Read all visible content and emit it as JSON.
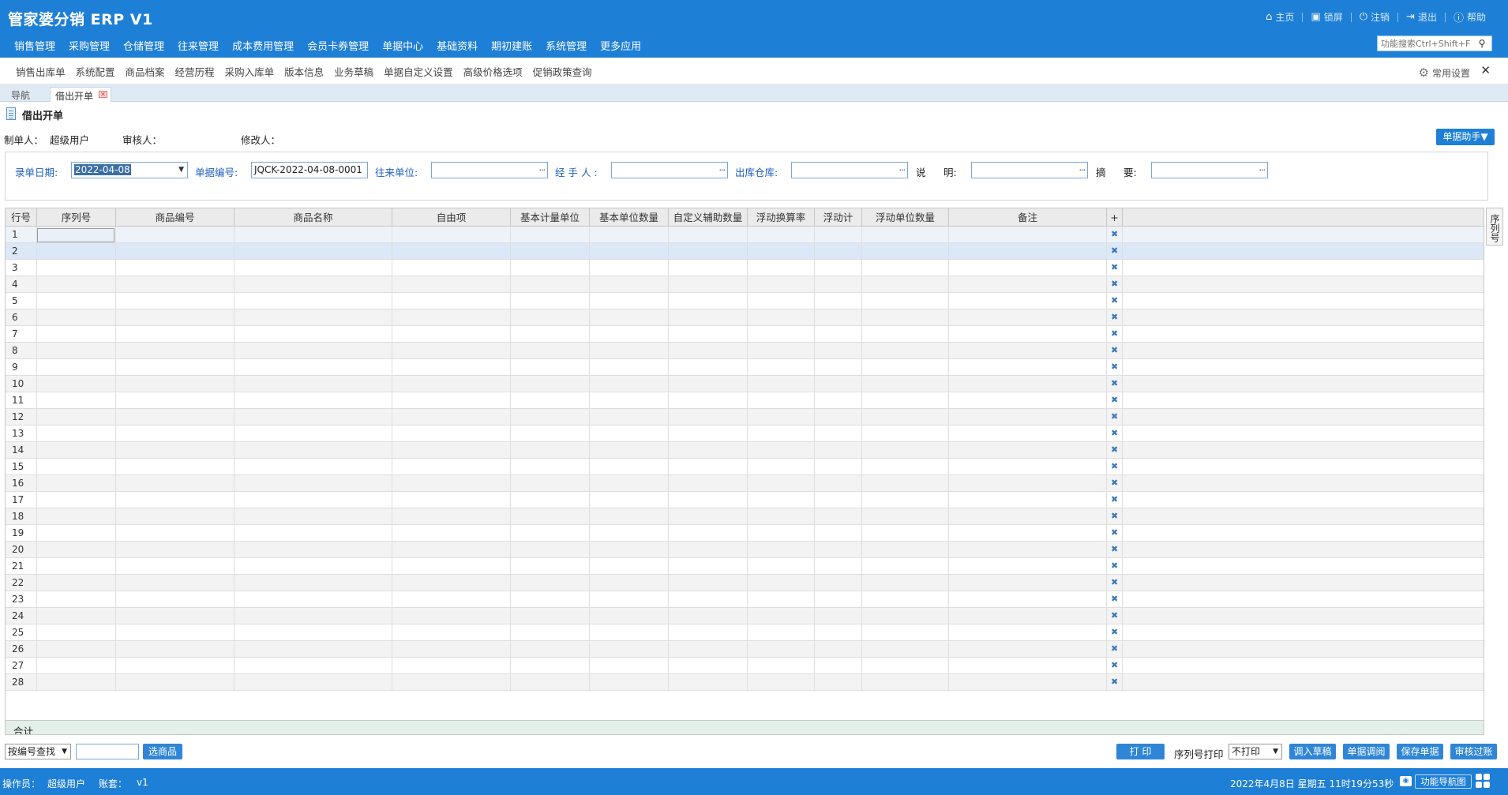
{
  "app": {
    "title": "管家婆分销 ERP V1"
  },
  "top_links": [
    {
      "label": "主页",
      "icon": "home-icon"
    },
    {
      "label": "锁屏",
      "icon": "lock-icon"
    },
    {
      "label": "注销",
      "icon": "power-icon"
    },
    {
      "label": "退出",
      "icon": "exit-icon"
    },
    {
      "label": "帮助",
      "icon": "info-icon"
    }
  ],
  "main_menu": [
    "销售管理",
    "采购管理",
    "仓储管理",
    "往来管理",
    "成本费用管理",
    "会员卡券管理",
    "单据中心",
    "基础资料",
    "期初建账",
    "系统管理",
    "更多应用"
  ],
  "search": {
    "placeholder": "功能搜索Ctrl+Shift+F"
  },
  "quick_links": [
    "销售出库单",
    "系统配置",
    "商品档案",
    "经营历程",
    "采购入库单",
    "版本信息",
    "业务草稿",
    "单据自定义设置",
    "高级价格选项",
    "促销政策查询"
  ],
  "quickbar": {
    "settings_label": "常用设置",
    "close": "✕"
  },
  "tabs": {
    "nav": "导航",
    "active": "借出开单",
    "close": "✕"
  },
  "doc": {
    "title": "借出开单",
    "maker_label": "制单人：",
    "maker_value": "超级用户",
    "auditor_label": "审核人：",
    "modifier_label": "修改人：",
    "assistant_button": "单据助手▼"
  },
  "form": {
    "date_label": "录单日期:",
    "date_value": "2022-04-08",
    "number_label": "单据编号:",
    "number_value": "JQCK-2022-04-08-0001",
    "partner_label": "往来单位:",
    "handler_label": "经 手 人 :",
    "warehouse_label": "出库仓库:",
    "note_label_a": "说",
    "note_label_b": "明:",
    "summary_label_a": "摘",
    "summary_label_b": "要:",
    "browse": "···"
  },
  "grid": {
    "columns": [
      "行号",
      "序列号",
      "商品编号",
      "商品名称",
      "自由项",
      "基本计量单位",
      "基本单位数量",
      "自定义辅助数量",
      "浮动换算率",
      "浮动计",
      "浮动单位数量",
      "备注",
      "+"
    ],
    "rows": [
      "1",
      "2",
      "3",
      "4",
      "5",
      "6",
      "7",
      "8",
      "9",
      "10",
      "11",
      "12",
      "13",
      "14",
      "15",
      "16",
      "17",
      "18",
      "19",
      "20",
      "21",
      "22",
      "23",
      "24",
      "25",
      "26",
      "27",
      "28"
    ],
    "delete_icon": "✖",
    "total_label": "合计",
    "side_tab": "序列号"
  },
  "actions": {
    "lookup_select": "按编号查找",
    "select_goods": "选商品",
    "print": "打 印",
    "serial_print_label": "序列号打印",
    "serial_print_value": "不打印",
    "load_draft": "调入草稿",
    "doc_lookup": "单据调阅",
    "save_doc": "保存单据",
    "audit_post": "审核过账"
  },
  "status": {
    "operator_label": "操作员：",
    "operator_value": "超级用户",
    "account_label": "账套：",
    "account_value": "v1",
    "datetime": "2022年4月8日  星期五  11时19分53秒",
    "nav_map_button": "功能导航图"
  }
}
